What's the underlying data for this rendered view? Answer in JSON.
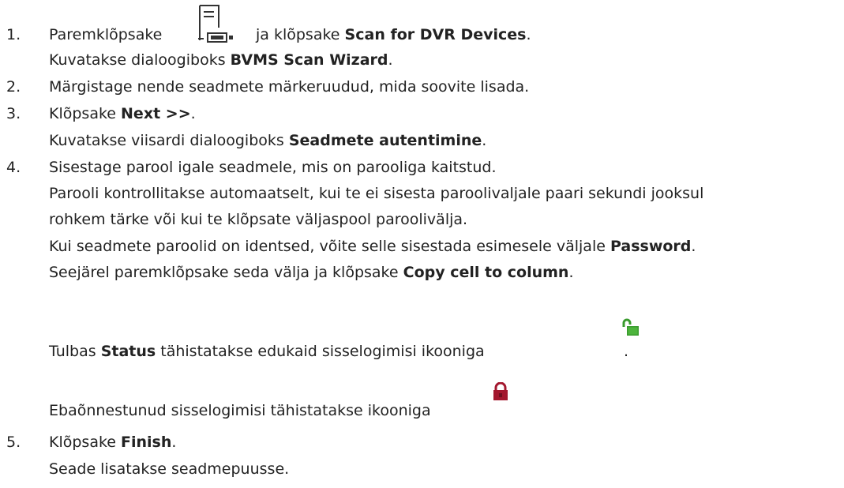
{
  "step1": {
    "number": "1.",
    "pre": "Paremklõpsake",
    "mid": "ja klõpsake",
    "bold": "Scan for DVR Devices",
    "post": ".",
    "result_pre": "Kuvatakse dialoogiboks",
    "result_bold": "BVMS Scan Wizard",
    "result_post": "."
  },
  "step2": {
    "number": "2.",
    "text": "Märgistage nende seadmete märkeruudud, mida soovite lisada."
  },
  "step3": {
    "number": "3.",
    "pre": "Klõpsake",
    "bold": "Next >>",
    "post": ".",
    "result_pre": "Kuvatakse viisardi dialoogiboks",
    "result_bold": "Seadmete autentimine",
    "result_post": "."
  },
  "step4": {
    "number": "4.",
    "text": "Sisestage parool igale seadmele, mis on parooliga kaitstud.",
    "para1_line1": "Parooli kontrollitakse automaatselt, kui te ei sisesta paroolivaljale paari sekundi jooksul",
    "para1_line2": "rohkem tärke või kui te klõpsate väljaspool paroolivälja.",
    "para2_pre": "Kui seadmete paroolid on identsed, võite selle sisestada esimesele väljale",
    "para2_bold": "Password",
    "para2_post": ".",
    "para3_pre": "Seejärel paremklõpsake seda välja ja klõpsake",
    "para3_bold": "Copy cell to column",
    "para3_post": ".",
    "status_pre": "Tulbas",
    "status_bold": "Status",
    "status_post": "tähistatakse edukaid sisselogimisi ikooniga",
    "status_end": ".",
    "fail_text": "Ebaõnnestunud sisselogimisi tähistatakse ikooniga"
  },
  "step5": {
    "number": "5.",
    "pre": "Klõpsake",
    "bold": "Finish",
    "post": ".",
    "result": "Seade lisatakse seadmepuusse."
  },
  "colors": {
    "text": "#222222",
    "unlock_green": "#3a9b2e",
    "lock_red": "#a3172e"
  },
  "icons": {
    "dvr": "dvr-device-icon",
    "unlocked": "unlocked-padlock-icon",
    "locked": "locked-padlock-icon"
  }
}
